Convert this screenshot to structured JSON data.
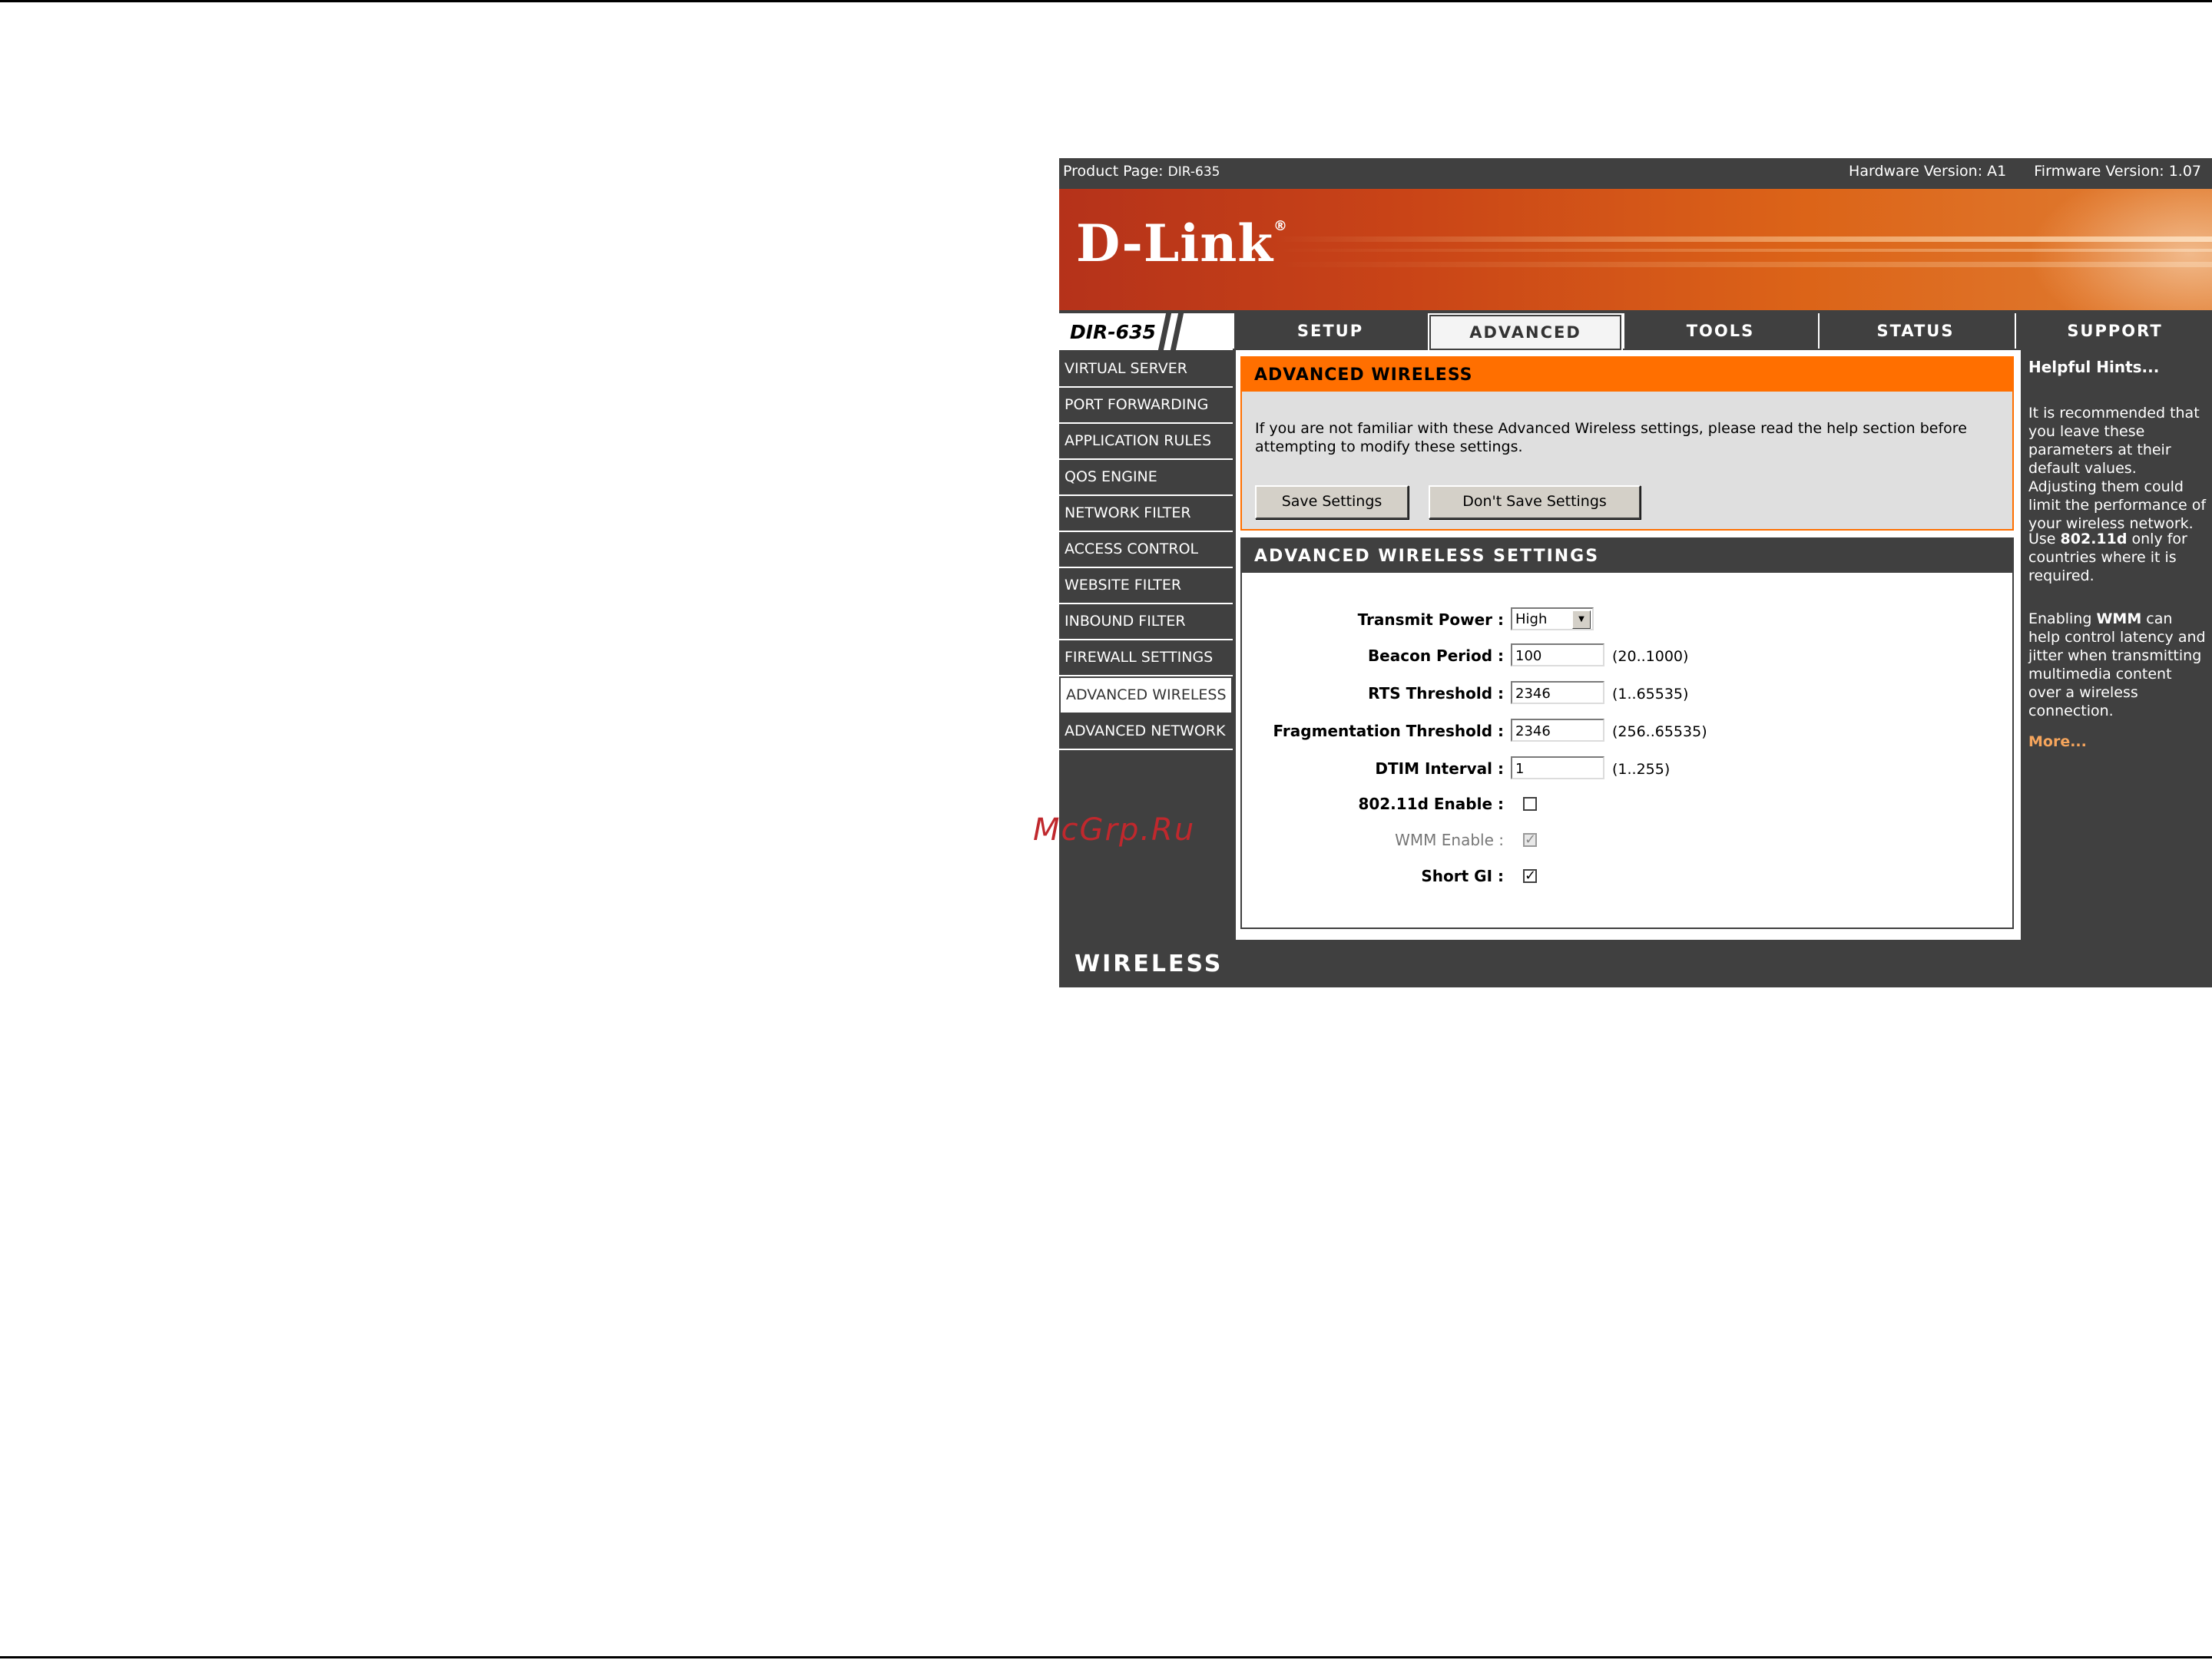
{
  "topbar": {
    "product_label": "Product Page:",
    "product_value": "DIR-635",
    "hardware": "Hardware Version: A1",
    "firmware": "Firmware Version: 1.07"
  },
  "logo": {
    "text": "D-Link",
    "mark": "®"
  },
  "model": "DIR-635",
  "tabs": [
    {
      "label": "SETUP",
      "active": false
    },
    {
      "label": "ADVANCED",
      "active": true
    },
    {
      "label": "TOOLS",
      "active": false
    },
    {
      "label": "STATUS",
      "active": false
    },
    {
      "label": "SUPPORT",
      "active": false
    }
  ],
  "sidebar": {
    "items": [
      {
        "label": "VIRTUAL SERVER"
      },
      {
        "label": "PORT FORWARDING"
      },
      {
        "label": "APPLICATION RULES"
      },
      {
        "label": "QOS ENGINE"
      },
      {
        "label": "NETWORK FILTER"
      },
      {
        "label": "ACCESS CONTROL"
      },
      {
        "label": "WEBSITE FILTER"
      },
      {
        "label": "INBOUND FILTER"
      },
      {
        "label": "FIREWALL SETTINGS"
      },
      {
        "label": "ADVANCED WIRELESS",
        "active": true
      },
      {
        "label": "ADVANCED NETWORK"
      }
    ]
  },
  "intro": {
    "title": "ADVANCED WIRELESS",
    "text": "If you are not familiar with these Advanced Wireless settings, please read the help section before attempting to modify these settings.",
    "save_label": "Save Settings",
    "dont_save_label": "Don't Save Settings"
  },
  "settings": {
    "title": "ADVANCED WIRELESS SETTINGS",
    "transmit_power": {
      "label": "Transmit Power :",
      "value": "High"
    },
    "beacon_period": {
      "label": "Beacon Period :",
      "value": "100",
      "range": "(20..1000)"
    },
    "rts_threshold": {
      "label": "RTS Threshold :",
      "value": "2346",
      "range": "(1..65535)"
    },
    "fragmentation_threshold": {
      "label": "Fragmentation Threshold :",
      "value": "2346",
      "range": "(256..65535)"
    },
    "dtim_interval": {
      "label": "DTIM Interval :",
      "value": "1",
      "range": "(1..255)"
    },
    "dot11d_enable": {
      "label": "802.11d Enable :",
      "checked": false
    },
    "wmm_enable": {
      "label": "WMM Enable :",
      "checked": true,
      "disabled": true
    },
    "short_gi": {
      "label": "Short GI :",
      "checked": true
    }
  },
  "hints": {
    "title": "Helpful Hints...",
    "p1": "It is recommended that you leave these parameters at their default values. Adjusting them could limit the performance of your wireless network.",
    "p2_pre": "Use ",
    "p2_bold": "802.11d",
    "p2_post": " only for countries where it is required.",
    "p3_pre": "Enabling ",
    "p3_bold": "WMM",
    "p3_post": " can help control latency and jitter when transmitting multimedia content over a wireless connection.",
    "more": "More..."
  },
  "footer": {
    "label": "WIRELESS"
  },
  "watermark": "McGrp.Ru",
  "colors": {
    "accent": "#ff6f00",
    "dark": "#404040",
    "panel": "#dfdfdf",
    "link": "#f6a55c"
  },
  "icons": {
    "checkbox_checked": "✓",
    "dropdown_arrow": "▼"
  }
}
